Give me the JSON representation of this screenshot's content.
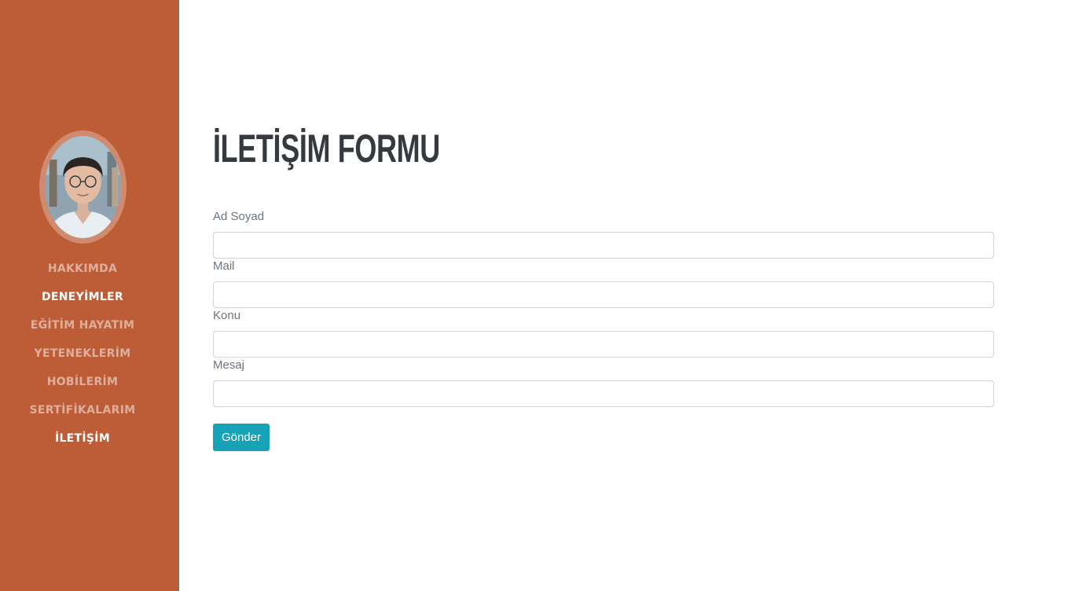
{
  "sidebar": {
    "nav": [
      {
        "label": "HAKKIMDA"
      },
      {
        "label": "DENEYİMLER"
      },
      {
        "label": "EĞİTİM HAYATIM"
      },
      {
        "label": "YETENEKLERİM"
      },
      {
        "label": "HOBİLERİM"
      },
      {
        "label": "SERTİFİKALARIM"
      },
      {
        "label": "İLETİŞİM"
      }
    ]
  },
  "main": {
    "title": "İLETİŞİM FORMU",
    "form": {
      "fields": [
        {
          "label": "Ad Soyad",
          "value": ""
        },
        {
          "label": "Mail",
          "value": ""
        },
        {
          "label": "Konu",
          "value": ""
        },
        {
          "label": "Mesaj",
          "value": ""
        }
      ],
      "submit_label": "Gönder"
    }
  },
  "colors": {
    "sidebar_bg": "#bd5d38",
    "title": "#343a40",
    "label": "#6c757d",
    "submit_bg": "#17a2b8"
  }
}
